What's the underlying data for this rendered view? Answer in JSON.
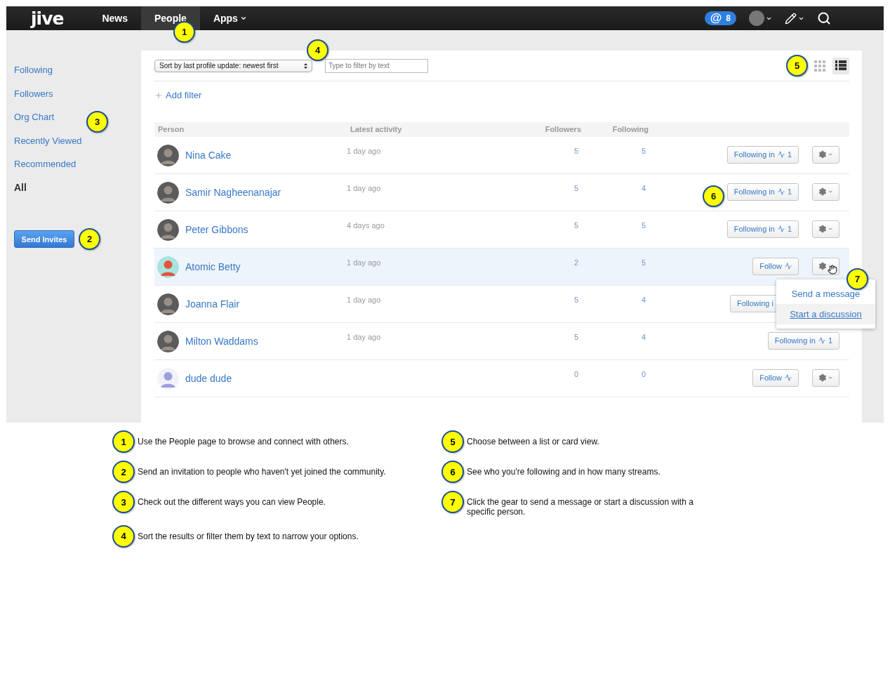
{
  "nav": {
    "logo": "jive",
    "items": [
      {
        "label": "News",
        "selected": false,
        "caret": false
      },
      {
        "label": "People",
        "selected": true,
        "caret": false
      },
      {
        "label": "Apps",
        "selected": false,
        "caret": true
      }
    ],
    "mentions": {
      "symbol": "@",
      "count": "8"
    }
  },
  "sidebar": {
    "items": [
      {
        "label": "Following",
        "selected": false
      },
      {
        "label": "Followers",
        "selected": false
      },
      {
        "label": "Org Chart",
        "selected": false
      },
      {
        "label": "Recently Viewed",
        "selected": false
      },
      {
        "label": "Recommended",
        "selected": false
      },
      {
        "label": "All",
        "selected": true
      }
    ],
    "button": "Send Invites"
  },
  "toolbar": {
    "sort": "Sort by last profile update: newest first",
    "filter_placeholder": "Type to filter by text",
    "views": [
      {
        "kind": "grid",
        "selected": false
      },
      {
        "kind": "list",
        "selected": true
      }
    ],
    "add_filter": "Add filter"
  },
  "table": {
    "columns": [
      "Person",
      "Latest activity",
      "Followers",
      "Following"
    ],
    "rows": [
      {
        "name": "Nina Cake",
        "avatar": {
          "kind": "photo"
        },
        "activity": "1 day ago",
        "followers": "5",
        "following": "5",
        "hover": false,
        "action": {
          "kind": "following",
          "label": "Following in",
          "count": "1"
        },
        "gear": true
      },
      {
        "name": "Samir Nagheenanajar",
        "avatar": {
          "kind": "photo"
        },
        "activity": "1 day ago",
        "followers": "5",
        "following": "4",
        "hover": false,
        "action": {
          "kind": "following",
          "label": "Following in",
          "count": "1"
        },
        "gear": true
      },
      {
        "name": "Peter Gibbons",
        "avatar": {
          "kind": "photo"
        },
        "activity": "4 days ago",
        "followers": "5",
        "following": "5",
        "hover": false,
        "action": {
          "kind": "following",
          "label": "Following in",
          "count": "1"
        },
        "gear": true
      },
      {
        "name": "Atomic Betty",
        "avatar": {
          "kind": "cartoon"
        },
        "activity": "1 day ago",
        "followers": "2",
        "following": "5",
        "hover": true,
        "action": {
          "kind": "follow",
          "label": "Follow"
        },
        "gear": true,
        "menu": [
          {
            "label": "Send a message",
            "selected": false
          },
          {
            "label": "Start a discussion",
            "selected": true
          }
        ]
      },
      {
        "name": "Joanna Flair",
        "avatar": {
          "kind": "photo"
        },
        "activity": "1 day ago",
        "followers": "5",
        "following": "4",
        "hover": false,
        "action": {
          "kind": "covered",
          "label": "Following i"
        },
        "gear": false
      },
      {
        "name": "Milton Waddams",
        "avatar": {
          "kind": "photo"
        },
        "activity": "1 day ago",
        "followers": "5",
        "following": "4",
        "hover": false,
        "action": {
          "kind": "following",
          "label": "Following in",
          "count": "1"
        },
        "gear": false
      },
      {
        "name": "dude dude",
        "avatar": {
          "kind": "default"
        },
        "followers": "0",
        "following": "0",
        "hover": false,
        "action": {
          "kind": "follow",
          "label": "Follow"
        },
        "gear": true
      }
    ]
  },
  "markers": [
    "1",
    "2",
    "3",
    "4",
    "5",
    "6",
    "7"
  ],
  "notes": [
    {
      "number": "1",
      "text": "Use the People page to browse and connect with others."
    },
    {
      "number": "5",
      "text": "Choose between a list or card view."
    },
    {
      "number": "2",
      "text": "Send an invitation to people who haven't yet joined the community."
    },
    {
      "number": "6",
      "text": "See who you're following and in how many streams."
    },
    {
      "number": "3",
      "text": "Check out the different ways you can view People."
    },
    {
      "number": "7",
      "text": "Click the gear to send a message or start a discussion with a specific person."
    },
    {
      "number": "4",
      "text": "Sort the results or filter them by text to narrow your options."
    }
  ]
}
